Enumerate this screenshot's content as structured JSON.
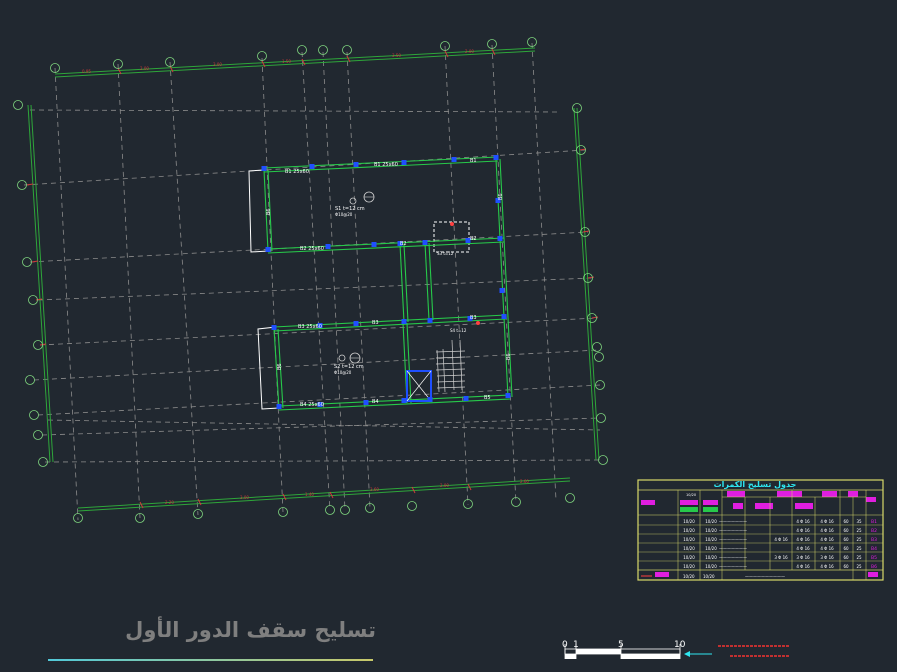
{
  "drawing": {
    "sheet_title": "تسليح سقف الدور الأول",
    "background": "#212830"
  },
  "schedule": {
    "title": "جدول تسليح الكمرات",
    "rows": [
      [
        "B1",
        "35",
        "60",
        "4 Φ 16",
        "4 Φ 16",
        "",
        "10/20",
        "10/20"
      ],
      [
        "B2",
        "25",
        "60",
        "4 Φ 16",
        "4 Φ 16",
        "",
        "10/20",
        "10/20"
      ],
      [
        "B3",
        "25",
        "60",
        "4 Φ 16",
        "4 Φ 16",
        "4 Φ 16",
        "10/20",
        "10/20"
      ],
      [
        "B4",
        "25",
        "60",
        "4 Φ 16",
        "4 Φ 16",
        "",
        "10/20",
        "10/20"
      ],
      [
        "B5",
        "25",
        "60",
        "3 Φ 16",
        "3 Φ 16",
        "3 Φ 16",
        "10/20",
        "10/20"
      ],
      [
        "B6",
        "25",
        "60",
        "4 Φ 16",
        "4 Φ 16",
        "",
        "10/20",
        "10/20"
      ]
    ]
  },
  "scale_bar": {
    "ticks": [
      "0",
      "1",
      "5",
      "10"
    ]
  },
  "colors": {
    "grid": "#8c8c8c",
    "beam": "#27c94a",
    "column": "#1f4fff",
    "wall": "#ffffff",
    "dimension": "#2ea63a",
    "magenta": "#e01ee0",
    "cyan": "#2ee6f0",
    "yellow": "#d8d86a",
    "bubble": "#7fd67f"
  }
}
